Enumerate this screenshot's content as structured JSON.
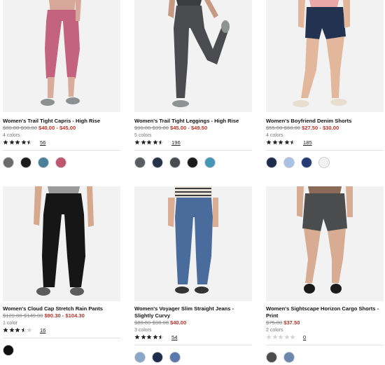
{
  "products": [
    {
      "title": "Women's Trail Tight Capris - High Rise",
      "old_price": "$80.00-$90.00",
      "sale_price": "$40.00 - $45.00",
      "colors_count": "4 colors",
      "rating": 4.5,
      "reviews": "56",
      "swatches": [
        "#6a6d6a",
        "#1c1c1c",
        "#4b7f9c",
        "#c0566e"
      ]
    },
    {
      "title": "Women's Trail Tight Leggings - High Rise",
      "old_price": "$90.00-$99.00",
      "sale_price": "$45.00 - $49.50",
      "colors_count": "5 colors",
      "rating": 4.5,
      "reviews": "196",
      "swatches": [
        "#5a5d60",
        "#263447",
        "#4a4d50",
        "#1c1c1c",
        "#4796b8"
      ]
    },
    {
      "title": "Women's Boyfriend Denim Shorts",
      "old_price": "$55.00-$60.00",
      "sale_price": "$27.50 - $30.00",
      "colors_count": "4 colors",
      "rating": 4.5,
      "reviews": "185",
      "swatches": [
        "#1f2d4d",
        "#a9c1e2",
        "#263a78",
        "#f1f1f4"
      ]
    },
    {
      "title": "Women's Cloud Cap Stretch Rain Pants",
      "old_price": "$129.00-$149.00",
      "sale_price": "$90.30 - $104.30",
      "colors_count": "1 color",
      "rating": 3.5,
      "reviews": "16",
      "swatches": [
        "#111111"
      ]
    },
    {
      "title": "Women's Voyager Slim Straight Jeans - Slightly Curvy",
      "old_price": "$80.00-$90.00",
      "sale_price": "$40.00",
      "colors_count": "3 colors",
      "rating": 4.5,
      "reviews": "54",
      "swatches": [
        "#8aa6c8",
        "#1f2d4d",
        "#5a78b0"
      ]
    },
    {
      "title": "Women's Sightscape Horizon Cargo Shorts - Print",
      "old_price": "$75.00",
      "sale_price": "$37.50",
      "colors_count": "2 colors",
      "rating": 0,
      "reviews": "0",
      "swatches": [
        "#4a4b4d",
        "#6c89ad"
      ]
    }
  ]
}
